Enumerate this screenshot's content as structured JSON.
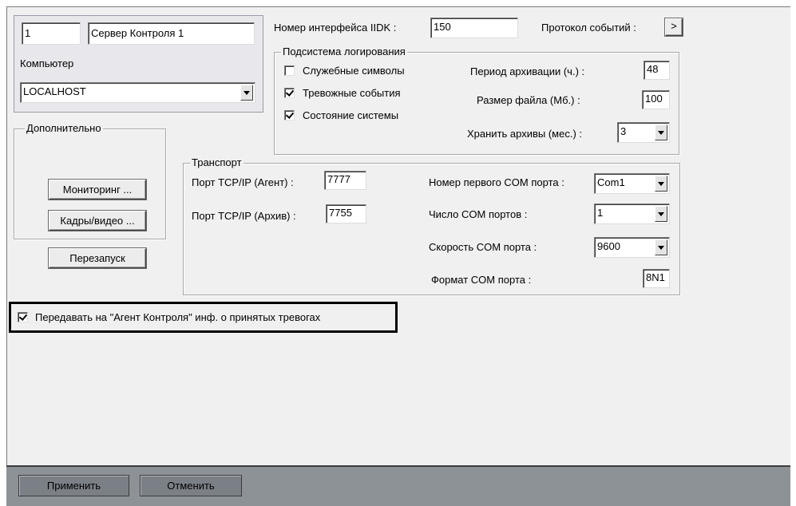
{
  "server": {
    "id": "1",
    "name": "Сервер Контроля 1"
  },
  "computer": {
    "label": "Компьютер",
    "value": "LOCALHOST"
  },
  "iidk": {
    "label": "Номер интерфейса IIDK :",
    "value": "150"
  },
  "events_protocol": {
    "label": "Протокол событий :",
    "button": ">"
  },
  "logging": {
    "legend": "Подсистема логирования",
    "service_symbols": {
      "label": "Служебные символы",
      "checked": false
    },
    "alarm_events": {
      "label": "Тревожные события",
      "checked": true
    },
    "system_state": {
      "label": "Состояние системы",
      "checked": true
    },
    "archive_period": {
      "label": "Период архивации (ч.) :",
      "value": "48"
    },
    "file_size": {
      "label": "Размер файла (Мб.) :",
      "value": "100"
    },
    "keep_archives": {
      "label": "Хранить архивы (мес.) :",
      "value": "3"
    }
  },
  "additional": {
    "legend": "Дополнительно",
    "monitoring": "Мониторинг ...",
    "frames_video": "Кадры/видео ..."
  },
  "restart": "Перезапуск",
  "transport": {
    "legend": "Транспорт",
    "tcp_agent": {
      "label": "Порт TCP/IP (Агент) :",
      "value": "7777"
    },
    "tcp_archive": {
      "label": "Порт TCP/IP (Архив) :",
      "value": "7755"
    },
    "first_com": {
      "label": "Номер первого COM порта :",
      "value": "Com1"
    },
    "com_count": {
      "label": "Число COM портов :",
      "value": "1"
    },
    "com_speed": {
      "label": "Скорость COM порта :",
      "value": "9600"
    },
    "com_format": {
      "label": "Формат COM порта :",
      "value": "8N1"
    }
  },
  "forward_alarms": {
    "label": "Передавать на \"Агент Контроля\" инф. о принятых тревогах",
    "checked": true
  },
  "footer": {
    "apply": "Применить",
    "cancel": "Отменить"
  }
}
